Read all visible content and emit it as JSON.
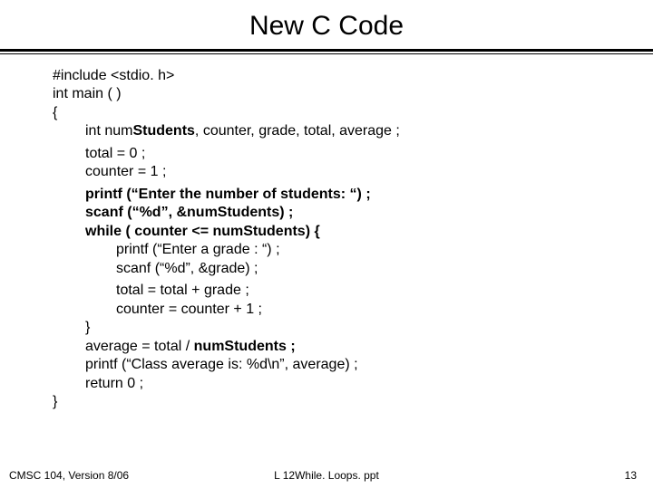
{
  "title": "New C Code",
  "code": {
    "l1": "#include <stdio. h>",
    "l2": "int main ( )",
    "l3": "{",
    "l4a": "int  num",
    "l4b": "Students",
    "l4c": ", counter, grade, total, average ;",
    "l5": "total = 0 ;",
    "l6": "counter = 1 ;",
    "l7a": "printf (“Enter the number of students: “) ;",
    "l8a": "scanf (“%d”, &num",
    "l8b": "Students) ;",
    "l9a": "while ( counter <= num",
    "l9b": "Students) {",
    "l10": "printf (“Enter a grade : “) ;",
    "l11": "scanf (“%d”, &grade) ;",
    "l12": "total = total + grade ;",
    "l13": "counter = counter + 1 ;",
    "l14": "}",
    "l15a": "average = total / ",
    "l15b": "num",
    "l15c": "Students ;",
    "l16": "printf (“Class average is: %d\\n”, average) ;",
    "l17": "return 0 ;",
    "l18": "}"
  },
  "footer": {
    "left": "CMSC 104, Version 8/06",
    "center": "L 12While. Loops. ppt",
    "right": "13"
  }
}
